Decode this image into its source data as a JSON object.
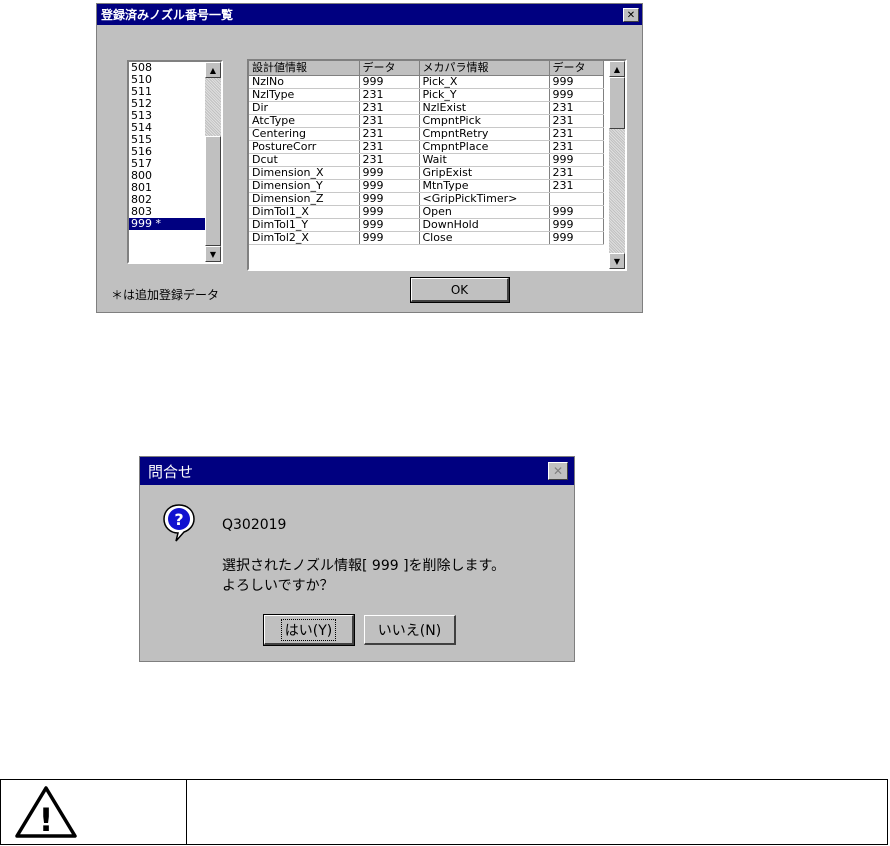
{
  "nozzle_window": {
    "title": "登録済みノズル番号一覧",
    "close_glyph": "✕",
    "nozzle_list": [
      "508",
      "510",
      "511",
      "512",
      "513",
      "514",
      "515",
      "516",
      "517",
      "800",
      "801",
      "802",
      "803",
      "999 *"
    ],
    "selected_index": 13,
    "table": {
      "headers": [
        "設計値情報",
        "データ",
        "メカパラ情報",
        "データ"
      ],
      "rows": [
        [
          "NzlNo",
          "999",
          "Pick_X",
          "999"
        ],
        [
          "NzlType",
          "231",
          "Pick_Y",
          "999"
        ],
        [
          "Dir",
          "231",
          "NzlExist",
          "231"
        ],
        [
          "AtcType",
          "231",
          "CmpntPick",
          "231"
        ],
        [
          "Centering",
          "231",
          "CmpntRetry",
          "231"
        ],
        [
          "PostureCorr",
          "231",
          "CmpntPlace",
          "231"
        ],
        [
          "Dcut",
          "231",
          "Wait",
          "999"
        ],
        [
          "Dimension_X",
          "999",
          "GripExist",
          "231"
        ],
        [
          "Dimension_Y",
          "999",
          "MtnType",
          "231"
        ],
        [
          "Dimension_Z",
          "999",
          "<GripPickTimer>",
          ""
        ],
        [
          "DimTol1_X",
          "999",
          "Open",
          "999"
        ],
        [
          "DimTol1_Y",
          "999",
          "DownHold",
          "999"
        ],
        [
          "DimTol2_X",
          "999",
          "Close",
          "999"
        ]
      ]
    },
    "note": "＊は追加登録データ",
    "ok_label": "OK"
  },
  "confirm_dialog": {
    "title": "問合せ",
    "close_glyph": "✕",
    "code": "Q302019",
    "message_line1": "選択されたノズル情報[ 999 ]を削除します。",
    "message_line2": "よろしいですか？",
    "yes_label": "はい(Y)",
    "no_label": "いいえ(N)",
    "icon_glyph": "?"
  },
  "warning_box": {
    "icon_glyph": "!"
  },
  "colors": {
    "titlebar": "#000080",
    "dialog_face": "#c0c0c0",
    "selection": "#000080"
  }
}
